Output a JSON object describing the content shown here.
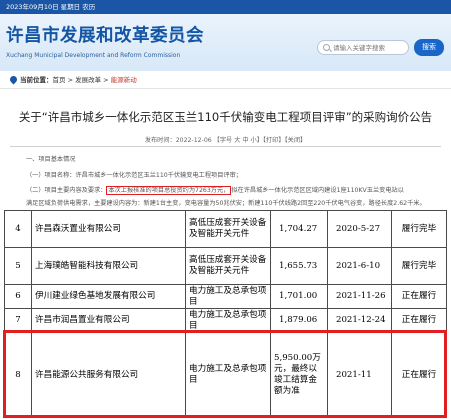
{
  "topbar": {
    "date": "2023年09月10日 星期日 农历"
  },
  "header": {
    "title_cn": "许昌市发展和改革委员会",
    "title_en": "Xuchang Municipal Development and Reform Commission",
    "search_placeholder": "请输入关键字搜索",
    "search_button": "搜索"
  },
  "breadcrumb": {
    "label": "当前位置：",
    "items": [
      "首页",
      "发展改革",
      "能源新动"
    ],
    "separator": " > "
  },
  "article": {
    "title": "关于“许昌市城乡一体化示范区玉兰110千伏输变电工程项目评审”的采购询价公告",
    "meta": "发布时间：2022-12-06 【字号 大 中 小】【打印】【关闭】",
    "p1": "一、项目基本情况",
    "p2": "（一）项目名称：许昌市城乡一体化示范区玉兰110千伏输变电工程项目评审；",
    "p3_prefix": "（二）项目主要内容及要求：",
    "p3_highlight": "本次上报核准的项目总投资约为7263万元，",
    "p3_suffix": "拟在许昌城乡一体化示范区区域内建设1座110KV玉兰变电站以",
    "p4": "满足区域负荷供电需求，主要建设内容为：新建1台主变，变电容量为50兆伏安；新建110千伏线路2回至220千伏电气谷变，路径长度2.62千米。"
  },
  "table": {
    "rows": [
      {
        "no": "4",
        "company": "许昌森沃置业有限公司",
        "type": "高低压成套开关设备及智能开关元件",
        "amount": "1,704.27",
        "date": "2020-5-27",
        "status": "履行完毕"
      },
      {
        "no": "5",
        "company": "上海璞皓智能科技有限公司",
        "type": "高低压成套开关设备及智能开关元件",
        "amount": "1,655.73",
        "date": "2021-6-10",
        "status": "履行完毕"
      },
      {
        "no": "6",
        "company": "伊川建业绿色基地发展有限公司",
        "type": "电力施工及总承包项目",
        "amount": "1,701.00",
        "date": "2021-11-26",
        "status": "正在履行"
      },
      {
        "no": "7",
        "company": "许昌市润昌置业有限公司",
        "type": "电力施工及总承包项目",
        "amount": "1,879.06",
        "date": "2021-12-24",
        "status": "正在履行"
      },
      {
        "no": "8",
        "company": "许昌能源公共服务有限公司",
        "type": "电力施工及总承包项目",
        "amount": "5,950.00万元，最终以竣工结算金额为准",
        "date": "2021-11",
        "status": "正在履行"
      }
    ]
  },
  "colors": {
    "brand_blue": "#1455a4",
    "highlight_red": "#e02020"
  }
}
